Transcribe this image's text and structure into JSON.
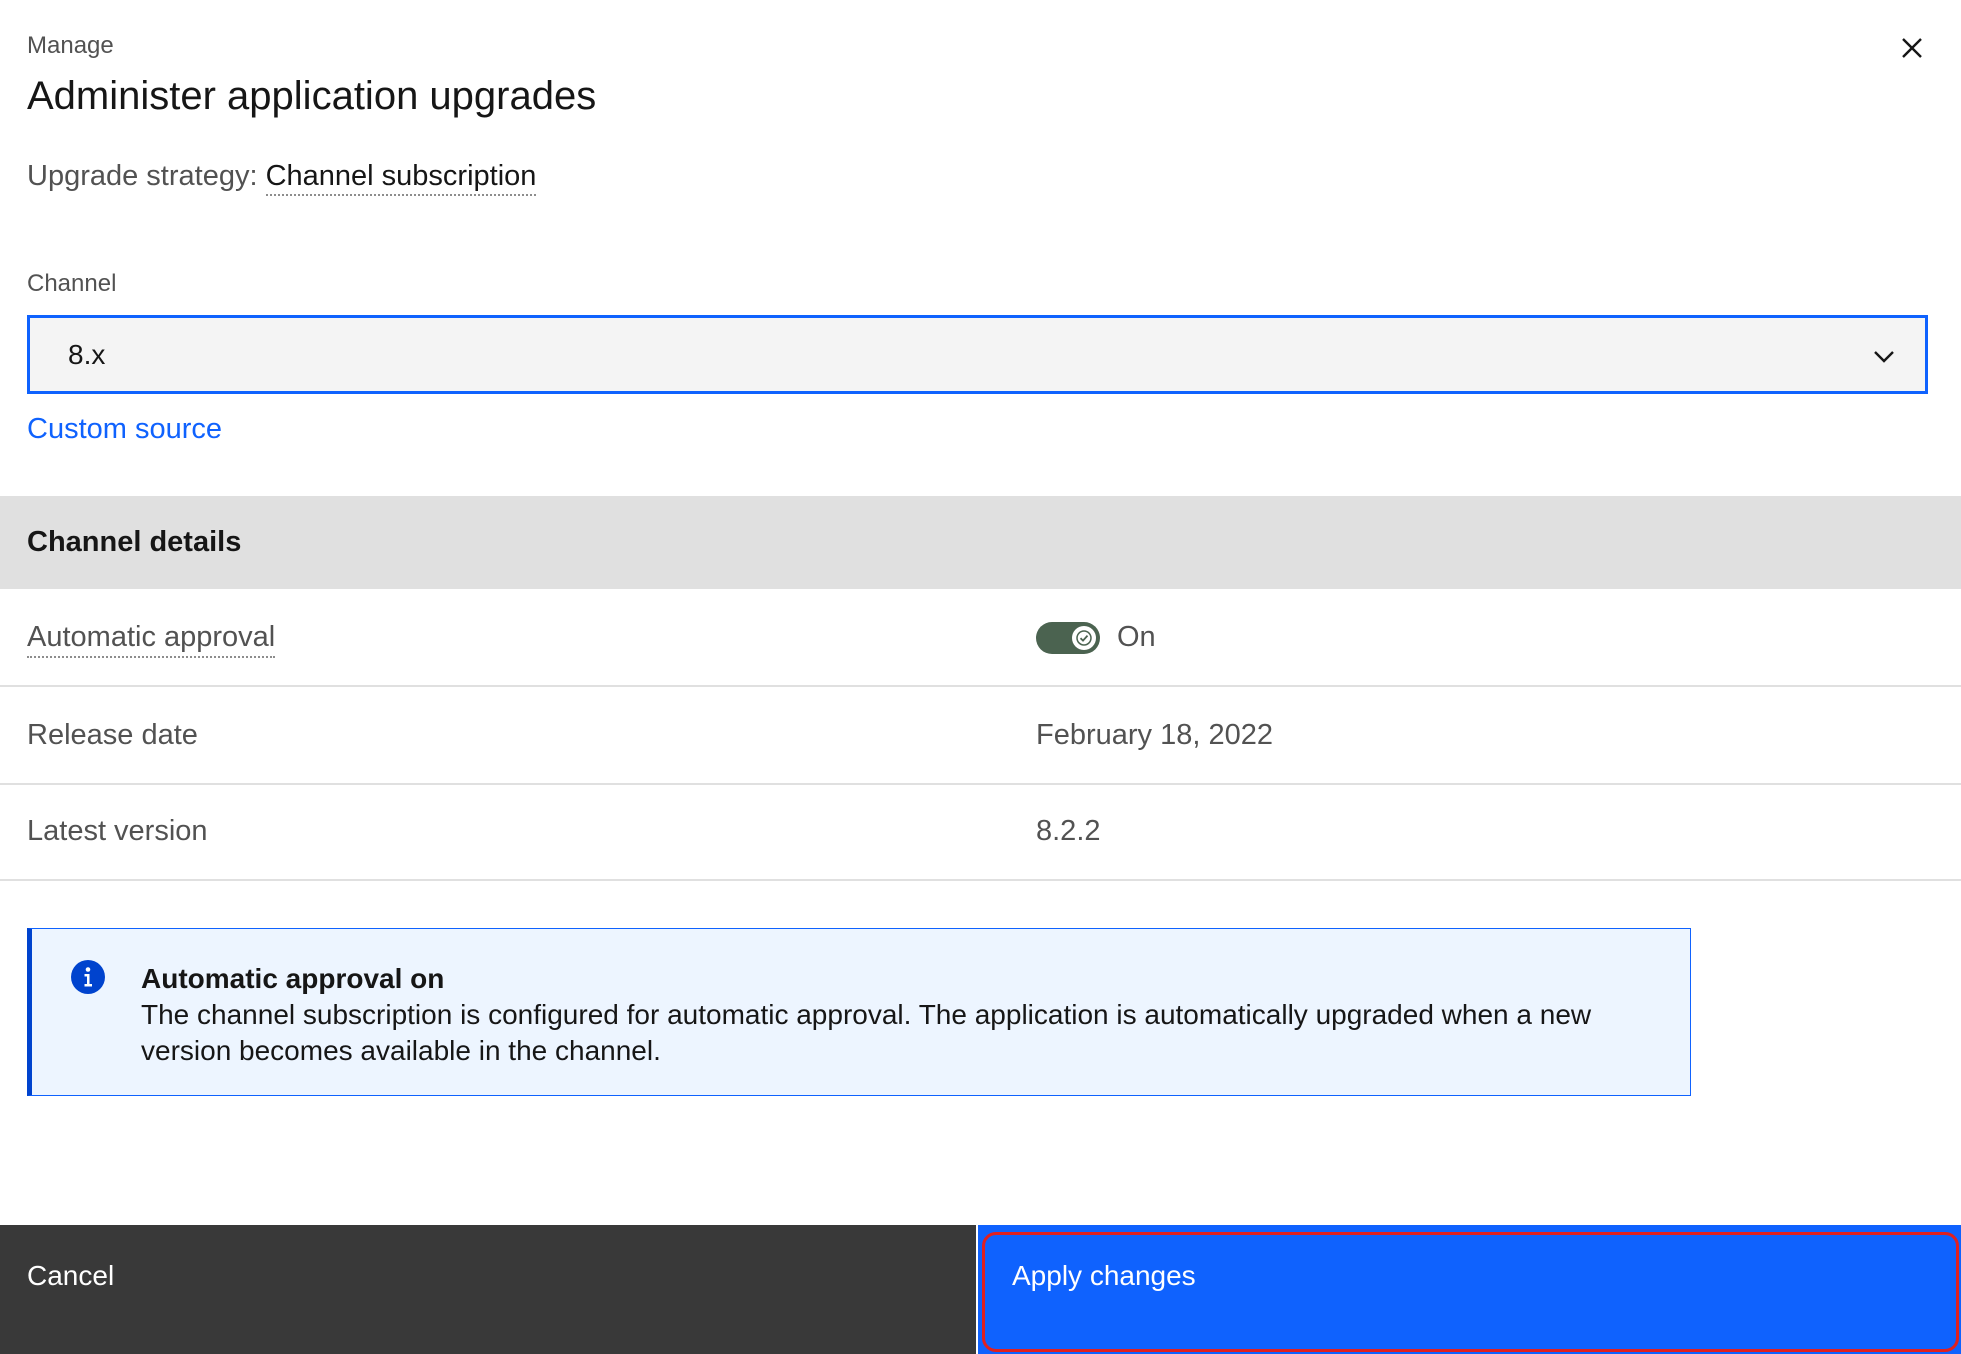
{
  "header": {
    "eyebrow": "Manage",
    "title": "Administer application upgrades",
    "close_icon": "close-icon"
  },
  "strategy": {
    "label": "Upgrade strategy:",
    "value": "Channel subscription"
  },
  "channel": {
    "label": "Channel",
    "selected": "8.x",
    "chevron_icon": "chevron-down-icon"
  },
  "custom_source_link": "Custom source",
  "details": {
    "header": "Channel details",
    "rows": [
      {
        "key": "Automatic approval",
        "value": "On",
        "type": "toggle",
        "toggle_on": true
      },
      {
        "key": "Release date",
        "value": "February 18, 2022"
      },
      {
        "key": "Latest version",
        "value": "8.2.2"
      }
    ]
  },
  "notification": {
    "icon": "information-icon",
    "title": "Automatic approval on",
    "body": "The channel subscription is configured for automatic approval. The application is automatically upgraded when a new version becomes available in the channel."
  },
  "footer": {
    "cancel_label": "Cancel",
    "apply_label": "Apply changes"
  },
  "colors": {
    "primary": "#0f62fe",
    "secondary_button": "#393939",
    "toggle_on": "#4b6350",
    "info_bg": "#edf5ff",
    "focus_ring": "#e02020"
  }
}
